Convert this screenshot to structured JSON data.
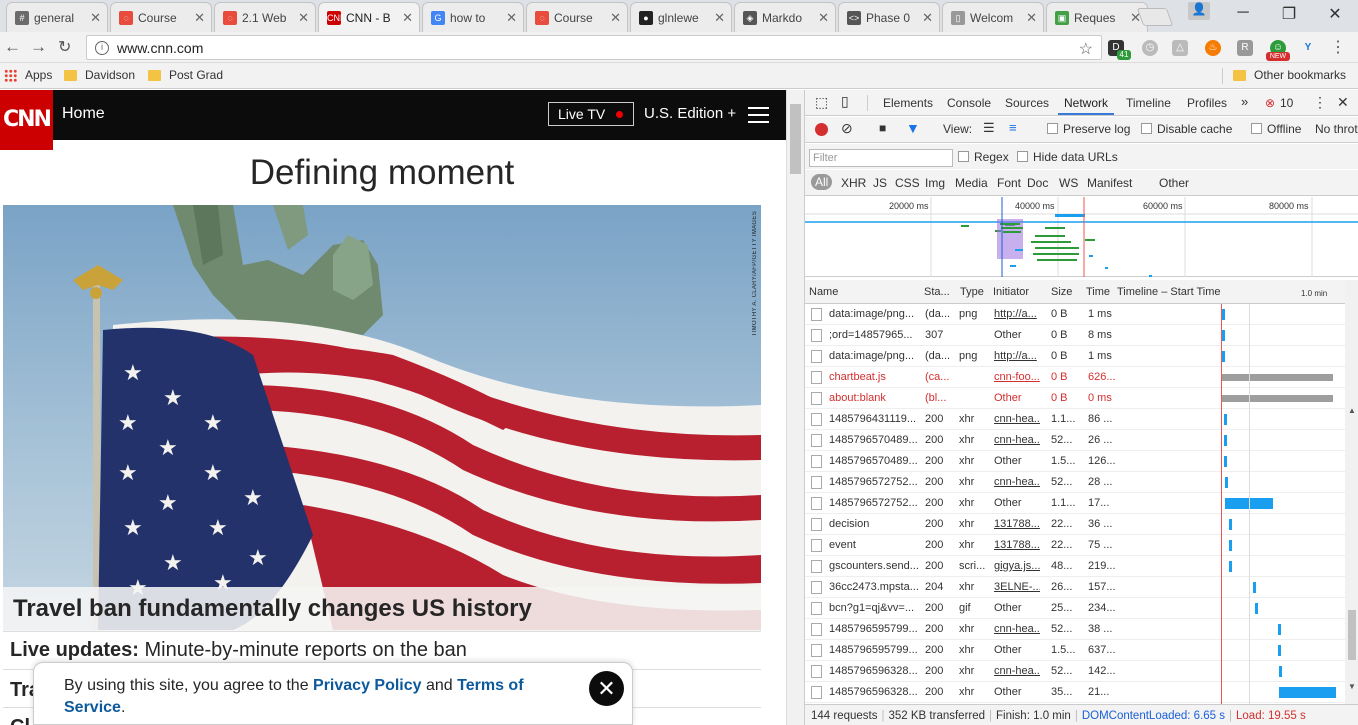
{
  "tabs": [
    {
      "title": "general",
      "fav_color": "#6b6b6b",
      "fav_text": "#"
    },
    {
      "title": "Course",
      "fav_color": "#e74c3c",
      "fav_text": "◌"
    },
    {
      "title": "2.1 Web",
      "fav_color": "#e74c3c",
      "fav_text": "◌"
    },
    {
      "title": "CNN - B",
      "fav_color": "#cc0000",
      "fav_text": "CNN"
    },
    {
      "title": "how to",
      "fav_color": "#4285f4",
      "fav_text": "G"
    },
    {
      "title": "Course",
      "fav_color": "#e74c3c",
      "fav_text": "◌"
    },
    {
      "title": "glnlewe",
      "fav_color": "#222222",
      "fav_text": "●"
    },
    {
      "title": "Markdo",
      "fav_color": "#555555",
      "fav_text": "◈"
    },
    {
      "title": "Phase 0",
      "fav_color": "#555555",
      "fav_text": "<>"
    },
    {
      "title": "Welcom",
      "fav_color": "#999999",
      "fav_text": "▯"
    },
    {
      "title": "Reques",
      "fav_color": "#43a047",
      "fav_text": "▣"
    }
  ],
  "active_tab": 3,
  "url": "www.cnn.com",
  "extension_badge": "41",
  "extension_new": "NEW",
  "bookmarks": {
    "apps": "Apps",
    "items": [
      "Davidson",
      "Post Grad"
    ],
    "other": "Other bookmarks"
  },
  "cnn": {
    "logo": "CNN",
    "home": "Home",
    "live_tv": "Live TV",
    "edition": "U.S. Edition +",
    "headline": "Defining moment",
    "photo_credit": "TIMOTHY A. CLARY/AFP/GETTY IMAGES",
    "caption": "Travel ban fundamentally changes US history",
    "live_bold": "Live updates:",
    "live_text": " Minute-by-minute reports on the ban",
    "partial1": "Tra",
    "partial2": "Cl"
  },
  "cookie": {
    "pre": "By using this site, you agree to the ",
    "privacy": "Privacy Policy",
    "and": " and ",
    "terms": "Terms of",
    "service": "Service",
    "dot": ".",
    "close": "✕"
  },
  "devtools": {
    "tabs": [
      "Elements",
      "Console",
      "Sources",
      "Network",
      "Timeline",
      "Profiles"
    ],
    "active": "Network",
    "more": "»",
    "errors": "10",
    "view": "View:",
    "preserve_log": "Preserve log",
    "disable_cache": "Disable cache",
    "offline": "Offline",
    "throttle": "No throt",
    "filter_placeholder": "Filter",
    "regex": "Regex",
    "hide_data_urls": "Hide data URLs",
    "types": [
      "All",
      "XHR",
      "JS",
      "CSS",
      "Img",
      "Media",
      "Font",
      "Doc",
      "WS",
      "Manifest",
      "Other"
    ],
    "overview_labels": [
      "20000 ms",
      "40000 ms",
      "60000 ms",
      "80000 ms"
    ],
    "columns": {
      "name": "Name",
      "status": "Sta...",
      "type": "Type",
      "initiator": "Initiator",
      "size": "Size",
      "time": "Time",
      "timeline": "Timeline – Start Time",
      "scale": "1.0 min"
    },
    "rows": [
      {
        "name": "data:image/png...",
        "status": "(da...",
        "type": "png",
        "initiator": "http://a...",
        "size": "0 B",
        "time": "1 ms",
        "err": false,
        "link": true,
        "start": 0.485,
        "width": 0.012
      },
      {
        "name": ";ord=14857965...",
        "status": "307",
        "type": "",
        "initiator": "Other",
        "size": "0 B",
        "time": "8 ms",
        "err": false,
        "link": false,
        "start": 0.485,
        "width": 0.012
      },
      {
        "name": "data:image/png...",
        "status": "(da...",
        "type": "png",
        "initiator": "http://a...",
        "size": "0 B",
        "time": "1 ms",
        "err": false,
        "link": true,
        "start": 0.485,
        "width": 0.012
      },
      {
        "name": "chartbeat.js",
        "status": "(ca...",
        "type": "",
        "initiator": "cnn-foo...",
        "size": "0 B",
        "time": "626...",
        "err": true,
        "link": true,
        "start": 0.485,
        "width": 0.515,
        "gray": true
      },
      {
        "name": "about:blank",
        "status": "(bl...",
        "type": "",
        "initiator": "Other",
        "size": "0 B",
        "time": "0 ms",
        "err": true,
        "link": false,
        "start": 0.485,
        "width": 0.515,
        "gray": true
      },
      {
        "name": "1485796431119...",
        "status": "200",
        "type": "xhr",
        "initiator": "cnn-hea...",
        "size": "1.1...",
        "time": "86 ...",
        "err": false,
        "link": true,
        "start": 0.495,
        "width": 0.012
      },
      {
        "name": "1485796570489...",
        "status": "200",
        "type": "xhr",
        "initiator": "cnn-hea...",
        "size": "52...",
        "time": "26 ...",
        "err": false,
        "link": true,
        "start": 0.497,
        "width": 0.012
      },
      {
        "name": "1485796570489...",
        "status": "200",
        "type": "xhr",
        "initiator": "Other",
        "size": "1.5...",
        "time": "126...",
        "err": false,
        "link": false,
        "start": 0.497,
        "width": 0.012
      },
      {
        "name": "1485796572752...",
        "status": "200",
        "type": "xhr",
        "initiator": "cnn-hea...",
        "size": "52...",
        "time": "28 ...",
        "err": false,
        "link": true,
        "start": 0.5,
        "width": 0.012
      },
      {
        "name": "1485796572752...",
        "status": "200",
        "type": "xhr",
        "initiator": "Other",
        "size": "1.1...",
        "time": "17...",
        "err": false,
        "link": false,
        "start": 0.5,
        "width": 0.22
      },
      {
        "name": "decision",
        "status": "200",
        "type": "xhr",
        "initiator": "131788...",
        "size": "22...",
        "time": "36 ...",
        "err": false,
        "link": true,
        "start": 0.52,
        "width": 0.012
      },
      {
        "name": "event",
        "status": "200",
        "type": "xhr",
        "initiator": "131788...",
        "size": "22...",
        "time": "75 ...",
        "err": false,
        "link": true,
        "start": 0.52,
        "width": 0.012
      },
      {
        "name": "gscounters.send...",
        "status": "200",
        "type": "scri...",
        "initiator": "gigya.js...",
        "size": "48...",
        "time": "219...",
        "err": false,
        "link": true,
        "start": 0.52,
        "width": 0.012
      },
      {
        "name": "36cc2473.mpsta...",
        "status": "204",
        "type": "xhr",
        "initiator": "3ELNE-...",
        "size": "26...",
        "time": "157...",
        "err": false,
        "link": true,
        "start": 0.63,
        "width": 0.012
      },
      {
        "name": "bcn?g1=qj&vv=...",
        "status": "200",
        "type": "gif",
        "initiator": "Other",
        "size": "25...",
        "time": "234...",
        "err": false,
        "link": false,
        "start": 0.64,
        "width": 0.012
      },
      {
        "name": "1485796595799...",
        "status": "200",
        "type": "xhr",
        "initiator": "cnn-hea...",
        "size": "52...",
        "time": "38 ...",
        "err": false,
        "link": true,
        "start": 0.745,
        "width": 0.012
      },
      {
        "name": "1485796595799...",
        "status": "200",
        "type": "xhr",
        "initiator": "Other",
        "size": "1.5...",
        "time": "637...",
        "err": false,
        "link": false,
        "start": 0.745,
        "width": 0.015
      },
      {
        "name": "1485796596328...",
        "status": "200",
        "type": "xhr",
        "initiator": "cnn-hea...",
        "size": "52...",
        "time": "142...",
        "err": false,
        "link": true,
        "start": 0.752,
        "width": 0.012
      },
      {
        "name": "1485796596328...",
        "status": "200",
        "type": "xhr",
        "initiator": "Other",
        "size": "35...",
        "time": "21...",
        "err": false,
        "link": false,
        "start": 0.752,
        "width": 0.26
      }
    ],
    "status": {
      "requests": "144 requests",
      "transferred": "352 KB transferred",
      "finish": "Finish: 1.0 min",
      "dcl": "DOMContentLoaded: 6.65 s",
      "load": "Load: 19.55 s"
    }
  }
}
